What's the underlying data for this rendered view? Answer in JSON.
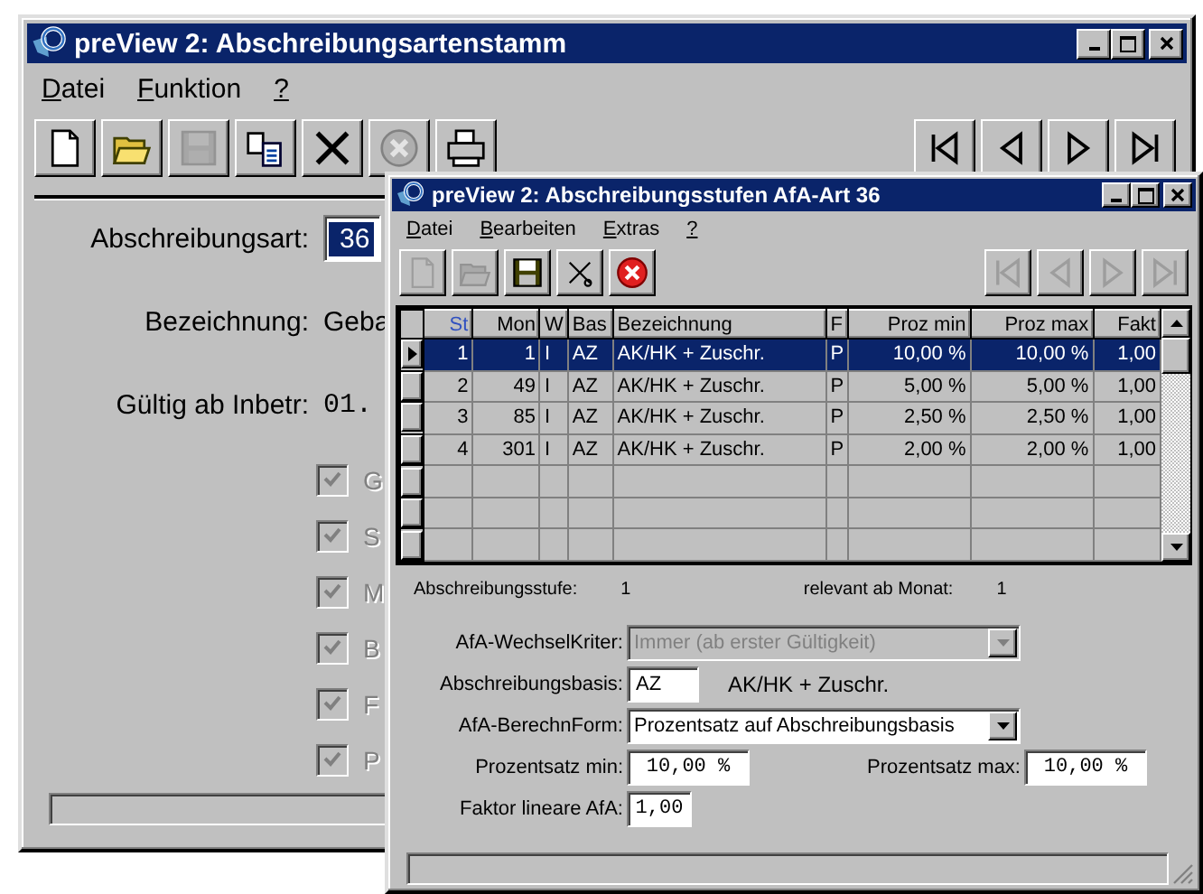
{
  "back_window": {
    "title": "preView 2: Abschreibungsartenstamm",
    "menu": [
      {
        "label": "Datei"
      },
      {
        "label": "Funktion"
      },
      {
        "label": "?"
      }
    ],
    "toolbar": [
      {
        "kind": "new",
        "disabled": false
      },
      {
        "kind": "open",
        "disabled": false
      },
      {
        "kind": "save",
        "disabled": true
      },
      {
        "kind": "copy",
        "disabled": false
      },
      {
        "kind": "delete",
        "disabled": false
      },
      {
        "kind": "cancel",
        "disabled": true
      },
      {
        "kind": "print",
        "disabled": false
      }
    ],
    "navigation": [
      {
        "kind": "first",
        "disabled": false
      },
      {
        "kind": "prev",
        "disabled": false
      },
      {
        "kind": "next",
        "disabled": false
      },
      {
        "kind": "last",
        "disabled": false
      }
    ],
    "abschreibungsart": {
      "label": "Abschreibungsart:",
      "value": "36"
    },
    "fields": [
      {
        "label": "Bezeichnung:",
        "value": "Geba",
        "kind": "text"
      },
      {
        "label": "Gültig ab Inbetr:",
        "value": "01.",
        "kind": "mono"
      }
    ],
    "checkboxes": [
      {
        "label": "G",
        "checked": true,
        "disabled": true
      },
      {
        "label": "S",
        "checked": true,
        "disabled": true
      },
      {
        "label": "M",
        "checked": true,
        "disabled": true
      },
      {
        "label": "B",
        "checked": true,
        "disabled": true
      },
      {
        "label": "F",
        "checked": true,
        "disabled": true
      },
      {
        "label": "P",
        "checked": true,
        "disabled": true
      }
    ]
  },
  "front_window": {
    "title": "preView 2: Abschreibungsstufen AfA-Art 36",
    "menu": [
      {
        "label": "Datei"
      },
      {
        "label": "Bearbeiten"
      },
      {
        "label": "Extras"
      },
      {
        "label": "?"
      }
    ],
    "toolbar": [
      {
        "kind": "new",
        "disabled": true
      },
      {
        "kind": "open",
        "disabled": true
      },
      {
        "kind": "save",
        "disabled": false
      },
      {
        "kind": "cut",
        "disabled": false
      },
      {
        "kind": "cancel",
        "disabled": false
      }
    ],
    "navigation": [
      {
        "kind": "first",
        "disabled": true
      },
      {
        "kind": "prev",
        "disabled": true
      },
      {
        "kind": "next",
        "disabled": true
      },
      {
        "kind": "last",
        "disabled": true
      }
    ],
    "table": {
      "columns": [
        {
          "label": "St",
          "kind": "number",
          "sorted": true
        },
        {
          "label": "Mon",
          "kind": "number",
          "sorted": false
        },
        {
          "label": "W",
          "kind": "text",
          "sorted": false
        },
        {
          "label": "Bas",
          "kind": "text",
          "sorted": false
        },
        {
          "label": "Bezeichnung",
          "kind": "text",
          "sorted": false
        },
        {
          "label": "F",
          "kind": "text",
          "sorted": false
        },
        {
          "label": "Proz min",
          "kind": "number",
          "sorted": false
        },
        {
          "label": "Proz max",
          "kind": "number",
          "sorted": false
        },
        {
          "label": "Fakt",
          "kind": "number",
          "sorted": false
        }
      ],
      "rows": [
        {
          "selected": true,
          "cells": [
            "1",
            "1",
            "I",
            "AZ",
            "AK/HK + Zuschr.",
            "P",
            "10,00 %",
            "10,00 %",
            "1,00"
          ]
        },
        {
          "selected": false,
          "cells": [
            "2",
            "49",
            "I",
            "AZ",
            "AK/HK + Zuschr.",
            "P",
            "5,00 %",
            "5,00 %",
            "1,00"
          ]
        },
        {
          "selected": false,
          "cells": [
            "3",
            "85",
            "I",
            "AZ",
            "AK/HK + Zuschr.",
            "P",
            "2,50 %",
            "2,50 %",
            "1,00"
          ]
        },
        {
          "selected": false,
          "cells": [
            "4",
            "301",
            "I",
            "AZ",
            "AK/HK + Zuschr.",
            "P",
            "2,00 %",
            "2,00 %",
            "1,00"
          ]
        }
      ]
    },
    "info": [
      {
        "label": "Abschreibungsstufe:",
        "value": "1"
      },
      {
        "label": "relevant ab Monat:",
        "value": "1"
      }
    ],
    "wechsel": {
      "label": "AfA-WechselKriter:",
      "value": "Immer (ab erster Gültigkeit)",
      "disabled": true
    },
    "basis": {
      "label": "Abschreibungsbasis:",
      "value": "AZ",
      "description": "AK/HK + Zuschr."
    },
    "berechn": {
      "label": "AfA-BerechnForm:",
      "value": "Prozentsatz auf Abschreibungsbasis",
      "disabled": false
    },
    "proz_min": {
      "label": "Prozentsatz min:",
      "value": "10,00 %"
    },
    "proz_max": {
      "label": "Prozentsatz max:",
      "value": "10,00 %"
    },
    "faktor": {
      "label": "Faktor lineare AfA:",
      "value": "1,00"
    }
  }
}
